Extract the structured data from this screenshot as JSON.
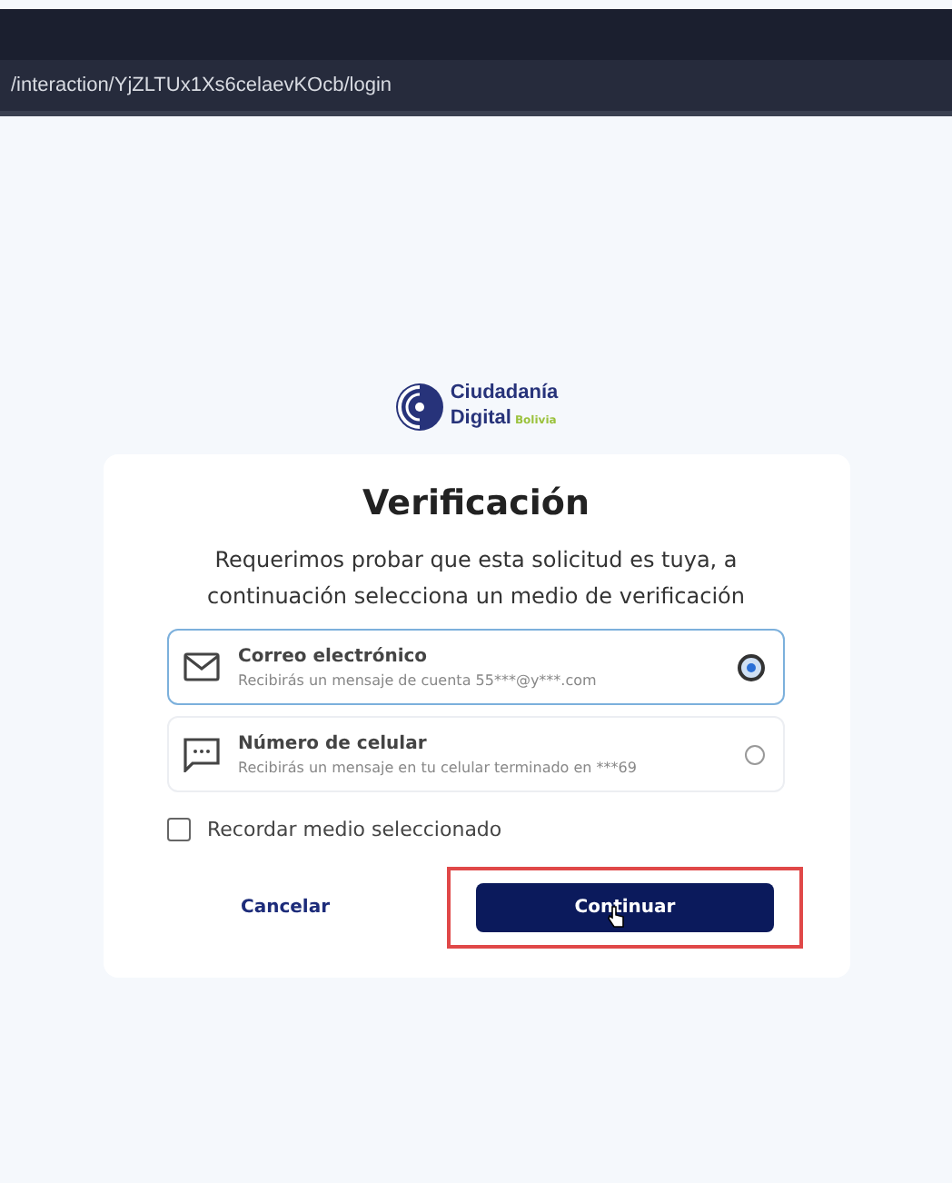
{
  "browser": {
    "address": "/interaction/YjZLTUx1Xs6celaevKOcb/login"
  },
  "logo": {
    "line_1": "Ciudadanía",
    "line_2": "Digital",
    "tag": "Bolivia"
  },
  "card": {
    "title": "Verificación",
    "description": "Requerimos probar que esta solicitud es tuya, a continuación selecciona un medio de verificación",
    "options": [
      {
        "kind": "email",
        "title": "Correo electrónico",
        "detail": "Recibirás un mensaje de cuenta 55***@y***.com",
        "selected": true
      },
      {
        "kind": "sms",
        "title": "Número de celular",
        "detail": "Recibirás un mensaje en tu celular terminado en ***69",
        "selected": false
      }
    ],
    "remember": {
      "label": "Recordar medio seleccionado",
      "checked": false
    },
    "cancel": "Cancelar",
    "continue": {
      "label": "Continuar",
      "highlighted": true
    }
  }
}
